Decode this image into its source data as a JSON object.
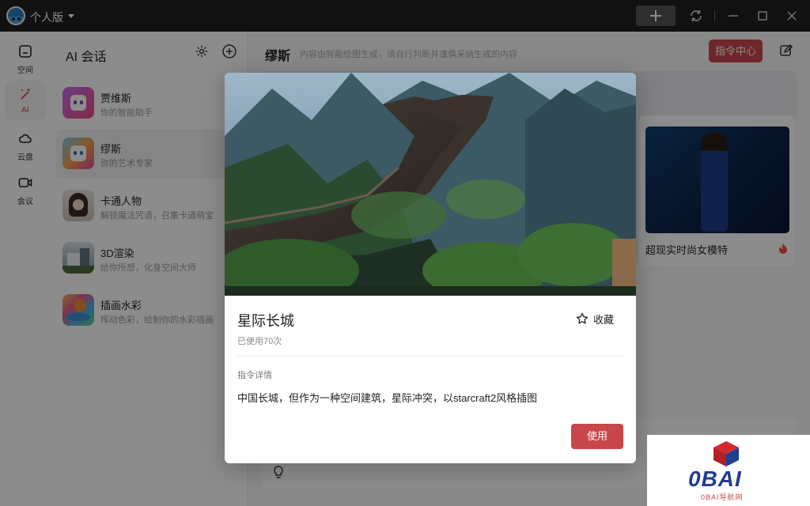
{
  "titlebar": {
    "edition": "个人版"
  },
  "rail": {
    "items": [
      {
        "label": "空间",
        "icon": "space-icon"
      },
      {
        "label": "AI",
        "icon": "magic-wand-icon",
        "active": true
      },
      {
        "label": "云盘",
        "icon": "cloud-icon"
      },
      {
        "label": "会议",
        "icon": "video-camera-icon"
      }
    ]
  },
  "sessions": {
    "title": "AI 会话",
    "items": [
      {
        "name": "贾维斯",
        "desc": "你的智能助手"
      },
      {
        "name": "缪斯",
        "desc": "你的艺术专家",
        "active": true
      },
      {
        "name": "卡通人物",
        "desc": "解锁魔法咒语，召集卡通萌宝"
      },
      {
        "name": "3D渲染",
        "desc": "给你所想，化身空间大师"
      },
      {
        "name": "插画水彩",
        "desc": "挥动色彩，绘制你的水彩插画"
      }
    ]
  },
  "main": {
    "title": "缪斯",
    "subtitle": "内容由智能绘图生成，请自行判断并谨慎采纳生成的内容",
    "command_center": "指令中心",
    "model_card_label": "超现实时尚女模特"
  },
  "modal": {
    "title": "星际长城",
    "usage": "已使用70次",
    "favorite": "收藏",
    "detail_label": "指令详情",
    "detail": "中国长城，但作为一种空间建筑，星际冲突，以starcraft2风格插图",
    "use_button": "使用"
  },
  "watermark": {
    "logo_text": "0BAI",
    "sub_text": "0BAI导航网"
  },
  "colors": {
    "accent": "#c8464a",
    "titlebar": "#1f1f1f",
    "logo_blue": "#1f3f8f"
  }
}
